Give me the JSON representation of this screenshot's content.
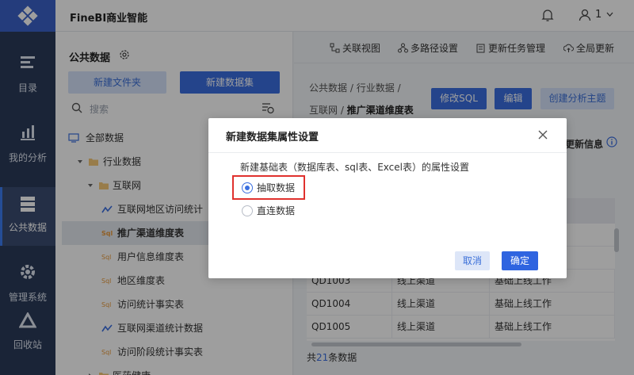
{
  "app": {
    "title": "FineBI商业智能",
    "user_label": "1"
  },
  "rail": {
    "items": [
      {
        "label": "目录"
      },
      {
        "label": "我的分析"
      },
      {
        "label": "公共数据"
      },
      {
        "label": "管理系统"
      },
      {
        "label": "回收站"
      }
    ]
  },
  "left_panel": {
    "title": "公共数据",
    "new_folder": "新建文件夹",
    "new_dataset": "新建数据集",
    "search_placeholder": "搜索",
    "tree": [
      {
        "label": "全部数据",
        "icon": "monitor-icon"
      },
      {
        "label": "行业数据",
        "icon": "folder-icon"
      },
      {
        "label": "互联网",
        "icon": "folder-icon"
      },
      {
        "label": "互联网地区访问统计",
        "icon": "line-chart-icon"
      },
      {
        "label": "推广渠道维度表",
        "icon": "sql-icon"
      },
      {
        "label": "用户信息维度表",
        "icon": "sql-icon"
      },
      {
        "label": "地区维度表",
        "icon": "sql-icon"
      },
      {
        "label": "访问统计事实表",
        "icon": "sql-icon"
      },
      {
        "label": "互联网渠道统计数据",
        "icon": "line-chart-icon"
      },
      {
        "label": "访问阶段统计事实表",
        "icon": "sql-icon"
      },
      {
        "label": "医药健康",
        "icon": "folder-icon"
      }
    ]
  },
  "toolbar": {
    "relation_view": "关联视图",
    "multi_path": "多路径设置",
    "update_tasks": "更新任务管理",
    "global_update": "全局更新"
  },
  "main": {
    "breadcrumb": {
      "l1": "公共数据",
      "sep": "/",
      "l2": "行业数据",
      "l3": "互联网",
      "current": "推广渠道维度表"
    },
    "edit_sql": "修改SQL",
    "edit": "编辑",
    "create_topic": "创建分析主题",
    "update_info": "更新信息",
    "table": {
      "rows": [
        [
          "QD1003",
          "线上渠道",
          "基础上线工作"
        ],
        [
          "QD1004",
          "线上渠道",
          "基础上线工作"
        ],
        [
          "QD1005",
          "线上渠道",
          "基础上线工作"
        ]
      ]
    },
    "total_prefix": "共",
    "total_count": "21",
    "total_suffix": "条数据"
  },
  "modal": {
    "title": "新建数据集属性设置",
    "description": "新建基础表（数据库表、sql表、Excel表）的属性设置",
    "options": [
      {
        "label": "抽取数据",
        "selected": true
      },
      {
        "label": "直连数据",
        "selected": false
      }
    ],
    "cancel": "取消",
    "confirm": "确定"
  },
  "colors": {
    "accent": "#3b6fe0",
    "rail": "#2a3a59",
    "highlight": "#e0312e"
  }
}
